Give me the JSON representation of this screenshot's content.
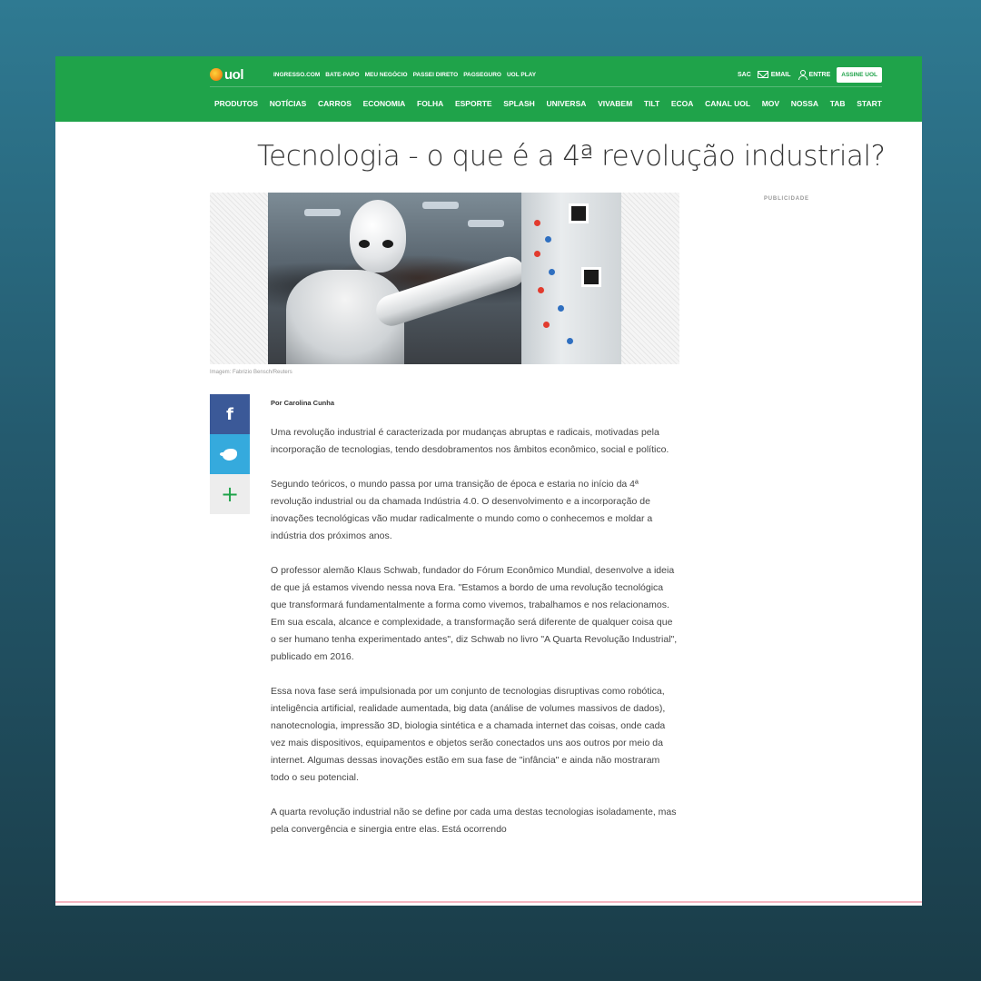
{
  "header": {
    "logo_text": "uol",
    "partner_links": [
      "INGRESSO.COM",
      "BATE-PAPO",
      "MEU NEGÓCIO",
      "PASSEI DIRETO",
      "PAGSEGURO",
      "UOL PLAY"
    ],
    "sac_label": "SAC",
    "email_label": "EMAIL",
    "login_label": "ENTRE",
    "subscribe_label": "ASSINE UOL",
    "nav_items": [
      "PRODUTOS",
      "NOTÍCIAS",
      "CARROS",
      "ECONOMIA",
      "FOLHA",
      "ESPORTE",
      "SPLASH",
      "UNIVERSA",
      "VIVABEM",
      "TILT",
      "ECOA",
      "CANAL UOL",
      "MOV",
      "NOSSA",
      "TAB",
      "START"
    ]
  },
  "article": {
    "title": "Tecnologia - o que é a 4ª revolução industrial?",
    "image_caption": "Imagem: Fabrizio Bensch/Reuters",
    "author": "Por Carolina Cunha",
    "paragraphs": [
      "Uma revolução industrial é caracterizada por mudanças abruptas e radicais, motivadas pela incorporação de tecnologias, tendo desdobramentos nos âmbitos econômico, social e político.",
      "Segundo teóricos, o mundo passa por uma transição de época e estaria no início da 4ª revolução industrial ou da chamada Indústria 4.0. O desenvolvimento e a incorporação de inovações tecnológicas vão mudar radicalmente o mundo como o conhecemos e moldar a indústria dos próximos anos.",
      "O professor alemão Klaus Schwab, fundador do Fórum Econômico Mundial, desenvolve a ideia de que já estamos vivendo nessa nova Era. \"Estamos a bordo de uma revolução tecnológica que transformará fundamentalmente a forma como vivemos, trabalhamos e nos relacionamos. Em sua escala, alcance e complexidade, a transformação será diferente de qualquer coisa que o ser humano tenha experimentado antes\", diz Schwab no livro \"A Quarta Revolução Industrial\", publicado em 2016.",
      "Essa nova fase será impulsionada por um conjunto de tecnologias disruptivas como robótica, inteligência artificial, realidade aumentada, big data (análise de volumes massivos de dados), nanotecnologia, impressão 3D, biologia sintética e a chamada internet das coisas, onde cada vez mais dispositivos, equipamentos e objetos serão conectados uns aos outros por meio da internet. Algumas dessas inovações estão em sua fase de \"infância\" e ainda não mostraram todo o seu potencial.",
      "A quarta revolução industrial não se define por cada uma destas tecnologias isoladamente, mas pela convergência e sinergia entre elas. Está ocorrendo"
    ]
  },
  "share": {
    "facebook_icon": "f",
    "more_icon": "+"
  },
  "sidebar": {
    "ad_label": "PUBLICIDADE"
  },
  "colors": {
    "brand_green": "#1fa34a",
    "facebook": "#3b5998",
    "twitter": "#35aadd"
  }
}
